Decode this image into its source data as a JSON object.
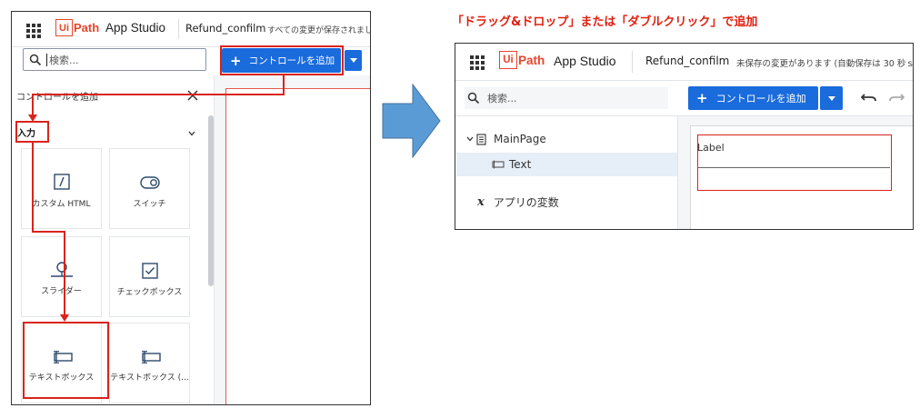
{
  "caption": "「ドラッグ&ドロップ」または「ダブルクリック」で追加",
  "left": {
    "logo_ui": "Ui",
    "logo_path": "Path",
    "app_name": "App Studio",
    "project_name": "Refund_confilm",
    "save_status": "すべての変更が保存されまし",
    "search_placeholder": "検索...",
    "add_control_label": "コントロールを追加",
    "panel_title": "コントロールを追加",
    "section_title": "入力",
    "cards": [
      {
        "label": "カスタム HTML",
        "icon": "custom-html-icon"
      },
      {
        "label": "スイッチ",
        "icon": "switch-icon"
      },
      {
        "label": "スライダー",
        "icon": "slider-icon"
      },
      {
        "label": "チェックボックス",
        "icon": "checkbox-icon"
      },
      {
        "label": "テキストボックス",
        "icon": "textbox-icon"
      },
      {
        "label": "テキストボックス (...",
        "icon": "textbox-icon"
      }
    ]
  },
  "right": {
    "logo_ui": "Ui",
    "logo_path": "Path",
    "app_name": "App Studio",
    "project_name": "Refund_confilm",
    "save_status": "未保存の変更があります (自動保存は 30 秒ｓ",
    "search_placeholder": "検索...",
    "add_control_label": "コントロールを追加",
    "tree": {
      "page": "MainPage",
      "child": "Text",
      "variables_symbol": "x",
      "variables": "アプリの変数"
    },
    "canvas_label": "Label"
  },
  "colors": {
    "accent_blue": "#1a6bdc",
    "highlight_red": "#d9241b",
    "brand_orange": "#e8452c",
    "arrow_blue": "#5b9bd5"
  }
}
